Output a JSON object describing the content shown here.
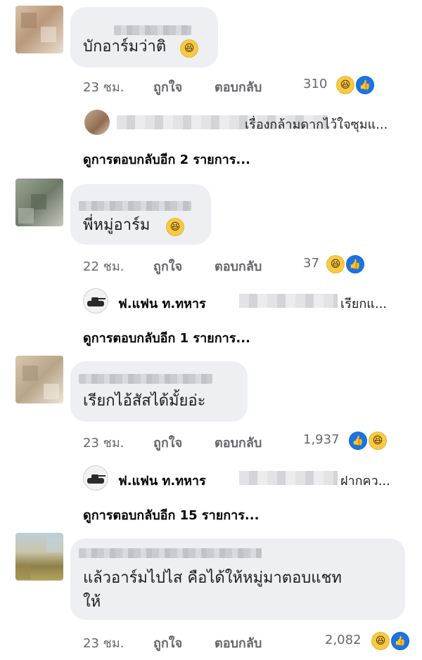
{
  "comments": [
    {
      "text": "บักอาร์มว่าติ",
      "time": "23 ชม.",
      "like_label": "ถูกใจ",
      "reply_label": "ตอบกลับ",
      "reaction_count": "310",
      "reactions": [
        "haha",
        "like"
      ],
      "reply_preview": {
        "name": "",
        "text": "เรื่องกล้ามดากไว้ใจซุมแ..."
      },
      "more_replies": "ดูการตอบกลับอีก 2 รายการ..."
    },
    {
      "text": "พี่หมู่อาร์ม",
      "time": "22 ชม.",
      "like_label": "ถูกใจ",
      "reply_label": "ตอบกลับ",
      "reaction_count": "37",
      "reactions": [
        "haha",
        "like"
      ],
      "reply_preview": {
        "name": "ฟ.แฟน ท.ทหาร",
        "text": "เรียกแ..."
      },
      "more_replies": "ดูการตอบกลับอีก 1 รายการ..."
    },
    {
      "text": "เรียกไอ้สัสได้มั้ยอ่ะ",
      "time": "23 ชม.",
      "like_label": "ถูกใจ",
      "reply_label": "ตอบกลับ",
      "reaction_count": "1,937",
      "reactions": [
        "like",
        "haha"
      ],
      "reply_preview": {
        "name": "ฟ.แฟน ท.ทหาร",
        "text": "ฝากคว..."
      },
      "more_replies": "ดูการตอบกลับอีก 15 รายการ..."
    },
    {
      "text_line1": "แล้วอาร์มไปไส คือได้ให้หมู่มาตอบแชท",
      "text_line2": "ให้",
      "time": "23 ชม.",
      "like_label": "ถูกใจ",
      "reply_label": "ตอบกลับ",
      "reaction_count": "2,082",
      "reactions": [
        "haha",
        "like"
      ]
    }
  ],
  "icons": {
    "haha": "haha-emoji-icon",
    "like": "like-thumb-icon",
    "tank": "tank-avatar-icon"
  },
  "colors": {
    "bubble": "#eeeff2",
    "meta": "#65676b",
    "like_blue": "#1b74e4",
    "haha_yellow": "#f7c945"
  },
  "glyphs": {
    "haha": "😆",
    "like": "👍"
  }
}
